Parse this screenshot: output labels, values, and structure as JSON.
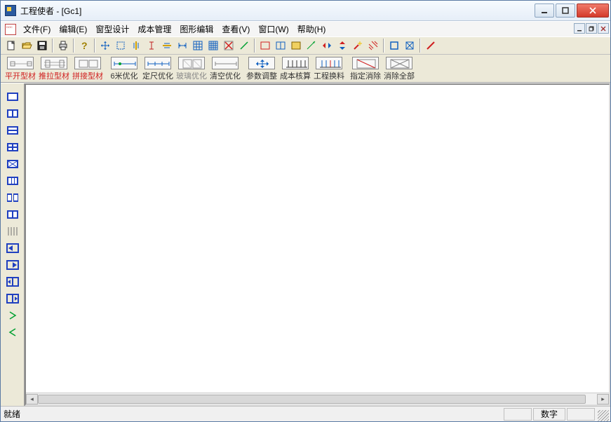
{
  "window": {
    "title": "工程使者 - [Gc1]"
  },
  "menu": {
    "items": [
      {
        "label": "文件(F)"
      },
      {
        "label": "编辑(E)"
      },
      {
        "label": "窗型设计"
      },
      {
        "label": "成本管理"
      },
      {
        "label": "图形编辑"
      },
      {
        "label": "查看(V)"
      },
      {
        "label": "窗口(W)"
      },
      {
        "label": "帮助(H)"
      }
    ]
  },
  "big_toolbar": {
    "items": [
      {
        "label": "平开型材",
        "red": true
      },
      {
        "label": "推拉型材",
        "red": true
      },
      {
        "label": "拼接型材",
        "red": true
      },
      {
        "label": "6米优化"
      },
      {
        "label": "定尺优化"
      },
      {
        "label": "玻璃优化",
        "disabled": true
      },
      {
        "label": "清空优化"
      },
      {
        "label": "参数调整"
      },
      {
        "label": "成本核算"
      },
      {
        "label": "工程换料"
      },
      {
        "label": "指定消除"
      },
      {
        "label": "消除全部"
      }
    ]
  },
  "statusbar": {
    "ready": "就绪",
    "numlock": "数字"
  }
}
